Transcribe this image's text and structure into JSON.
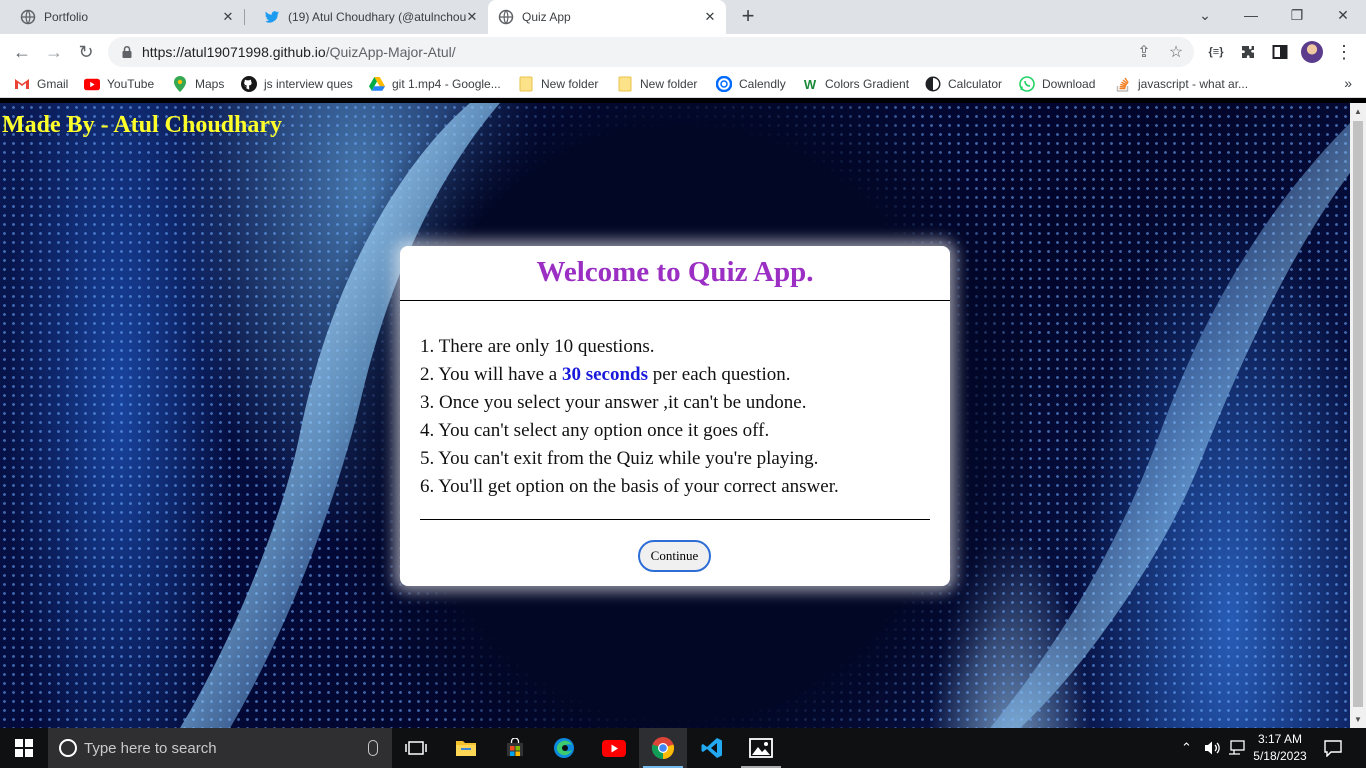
{
  "browser": {
    "tabs": [
      {
        "title": "Portfolio",
        "icon": "globe-icon"
      },
      {
        "title": "(19) Atul Choudhary (@atulnchou",
        "icon": "twitter-icon"
      },
      {
        "title": "Quiz App",
        "icon": "globe-icon",
        "active": true
      }
    ],
    "url_host": "https://atul19071998.github.io",
    "url_path": "/QuizApp-Major-Atul/",
    "bookmarks": [
      {
        "label": "Gmail",
        "icon": "gmail-icon"
      },
      {
        "label": "YouTube",
        "icon": "youtube-icon"
      },
      {
        "label": "Maps",
        "icon": "maps-icon"
      },
      {
        "label": "js interview ques",
        "icon": "github-icon"
      },
      {
        "label": "git 1.mp4 - Google...",
        "icon": "google-drive-icon"
      },
      {
        "label": "New folder",
        "icon": "folder-icon"
      },
      {
        "label": "New folder",
        "icon": "folder-icon"
      },
      {
        "label": "Calendly",
        "icon": "calendly-icon"
      },
      {
        "label": "Colors Gradient",
        "icon": "webgradients-icon"
      },
      {
        "label": "Calculator",
        "icon": "calculator-icon"
      },
      {
        "label": "Download",
        "icon": "whatsapp-icon"
      },
      {
        "label": "javascript - what ar...",
        "icon": "stackoverflow-icon"
      }
    ]
  },
  "page": {
    "made_by": "Made By - Atul Choudhary",
    "quiz": {
      "title": "Welcome to Quiz App.",
      "rules": [
        {
          "before": "1. There are only 10 questions.",
          "highlight": "",
          "after": ""
        },
        {
          "before": "2. You will have a ",
          "highlight": "30 seconds",
          "after": " per each question."
        },
        {
          "before": "3. Once you select your answer ,it can't be undone.",
          "highlight": "",
          "after": ""
        },
        {
          "before": "4. You can't select any option once it goes off.",
          "highlight": "",
          "after": ""
        },
        {
          "before": "5. You can't exit from the Quiz while you're playing.",
          "highlight": "",
          "after": ""
        },
        {
          "before": "6. You'll get option on the basis of your correct answer.",
          "highlight": "",
          "after": ""
        }
      ],
      "continue_label": "Continue"
    },
    "colors": {
      "title": "#9b2fc4",
      "highlight": "#1a1adb",
      "made_by": "#ffff2a"
    }
  },
  "taskbar": {
    "search_placeholder": "Type here to search",
    "time": "3:17 AM",
    "date": "5/18/2023"
  }
}
